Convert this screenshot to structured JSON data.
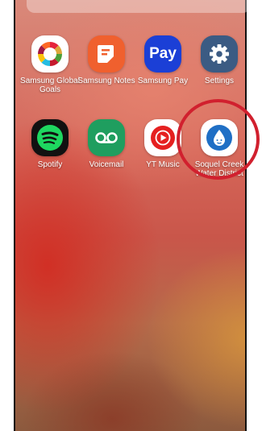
{
  "apps": [
    {
      "key": "global-goals",
      "label": "Samsung Global Goals",
      "icon": "global-goals-wheel-icon",
      "bg": "#ffffff"
    },
    {
      "key": "notes",
      "label": "Samsung Notes",
      "icon": "notes-icon",
      "bg": "#f0602e"
    },
    {
      "key": "pay",
      "label": "Samsung Pay",
      "icon": "pay-icon",
      "icon_text": "Pay",
      "bg": "#1b3fd6"
    },
    {
      "key": "settings",
      "label": "Settings",
      "icon": "gear-icon",
      "bg": "#3b5b83"
    },
    {
      "key": "spotify",
      "label": "Spotify",
      "icon": "spotify-icon",
      "bg": "#111111",
      "accent": "#1ed760"
    },
    {
      "key": "voicemail",
      "label": "Voicemail",
      "icon": "voicemail-icon",
      "bg": "#1f9e5f"
    },
    {
      "key": "yt-music",
      "label": "YT Music",
      "icon": "yt-music-icon",
      "bg": "#ffffff",
      "accent": "#e52020"
    },
    {
      "key": "soquel-creek",
      "label": "Soquel Creek Water District",
      "icon": "water-drop-icon",
      "bg": "#ffffff",
      "accent": "#1f6fc5"
    }
  ],
  "highlight_color": "#d1202e"
}
